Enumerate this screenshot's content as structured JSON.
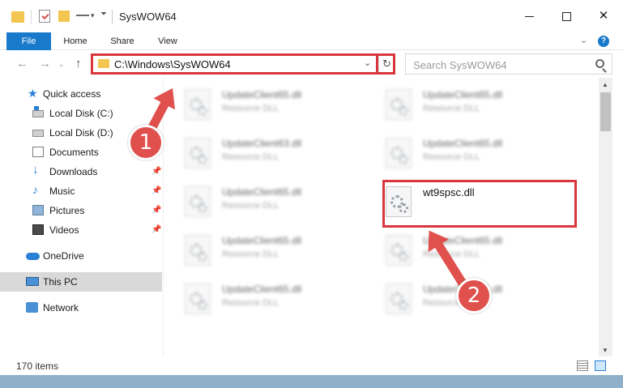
{
  "window": {
    "title": "SysWOW64",
    "min_glyph": "",
    "max_glyph": "",
    "close_glyph": "✕"
  },
  "ribbon": {
    "tabs": [
      "File",
      "Home",
      "Share",
      "View"
    ],
    "caret": "⌄",
    "help": "?"
  },
  "nav": {
    "back": "←",
    "forward": "→",
    "recent": "⌄",
    "up": "↑",
    "address": "C:\\Windows\\SysWOW64",
    "address_drop": "⌄",
    "refresh": "↻",
    "search_placeholder": "Search SysWOW64"
  },
  "sidebar": {
    "items": [
      {
        "label": "Quick access",
        "icon": "star-icon"
      },
      {
        "label": "Local Disk (C:)",
        "icon": "drive-c-icon"
      },
      {
        "label": "Local Disk (D:)",
        "icon": "drive-d-icon"
      },
      {
        "label": "Documents",
        "icon": "documents-icon"
      },
      {
        "label": "Downloads",
        "icon": "downloads-icon",
        "pinned": true
      },
      {
        "label": "Music",
        "icon": "music-icon",
        "pinned": true
      },
      {
        "label": "Pictures",
        "icon": "pictures-icon",
        "pinned": true
      },
      {
        "label": "Videos",
        "icon": "videos-icon",
        "pinned": true
      },
      {
        "label": "OneDrive",
        "icon": "onedrive-icon"
      },
      {
        "label": "This PC",
        "icon": "this-pc-icon",
        "selected": true
      },
      {
        "label": "Network",
        "icon": "network-icon"
      }
    ],
    "pin_glyph": "📌"
  },
  "files": [
    {
      "name": "UpdateClient65.dll",
      "type": "Resource DLL"
    },
    {
      "name": "UpdateClient65.dll",
      "type": "Resource DLL"
    },
    {
      "name": "UpdateClient63.dll",
      "type": "Resource DLL"
    },
    {
      "name": "UpdateClient65.dll",
      "type": "Resource DLL"
    },
    {
      "name": "UpdateClient65.dll",
      "type": "Resource DLL"
    },
    {
      "name": "wt9spsc.dll",
      "type": ""
    },
    {
      "name": "UpdateClient65.dll",
      "type": "Resource DLL"
    },
    {
      "name": "UpdateClient65.dll",
      "type": "Resource DLL"
    },
    {
      "name": "UpdateClient65.dll",
      "type": "Resource DLL"
    },
    {
      "name": "UpdateClient65.dll",
      "type": "Resource DLL"
    }
  ],
  "status": {
    "item_count": "170 items"
  },
  "annotations": {
    "step1": "1",
    "step2": "2",
    "color": "#d9363e"
  },
  "colors": {
    "accent": "#1979ca",
    "selection": "#d9d9d9"
  }
}
